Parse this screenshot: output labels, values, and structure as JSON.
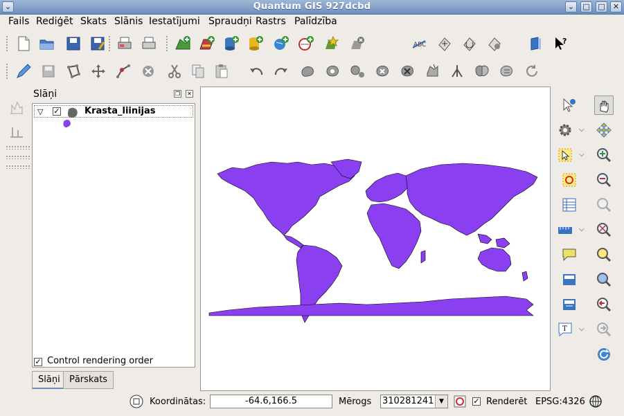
{
  "window": {
    "title": "Quantum GIS 927dcbd"
  },
  "menu": [
    "Fails",
    "Rediģēt",
    "Skats",
    "Slānis",
    "Iestatījumi",
    "Spraudņi",
    "Rastrs",
    "Palīdzība"
  ],
  "layers_panel": {
    "title": "Slāņi",
    "layers": [
      {
        "name": "Krasta_liinijas",
        "checked": true,
        "color": "#8a3ff0"
      }
    ],
    "control_rendering_order": "Control rendering order",
    "tabs": [
      "Slāņi",
      "Pārskats"
    ]
  },
  "status": {
    "coord_label": "Koordinātas:",
    "coord_value": "-64.6,166.5",
    "scale_label": "Mērogs",
    "scale_value": "310281241",
    "render_label": "Renderēt",
    "crs": "EPSG:4326"
  },
  "colors": {
    "land": "#8a3ff0",
    "titlebar": "#7393c0"
  }
}
